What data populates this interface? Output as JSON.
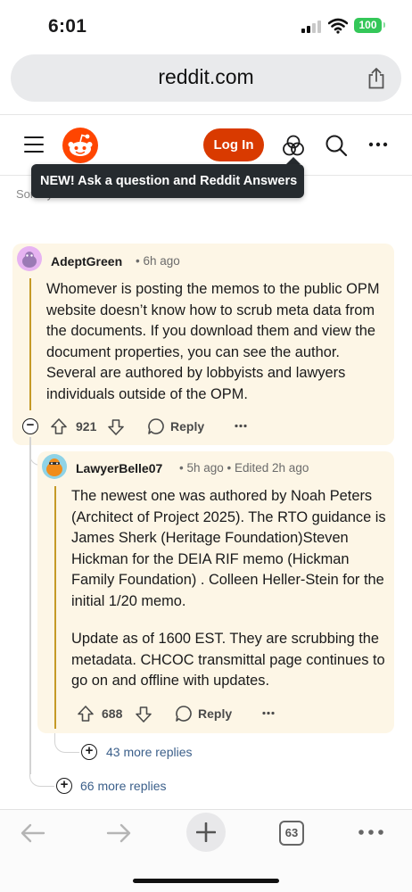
{
  "status_bar": {
    "time": "6:01",
    "battery": "100"
  },
  "browser": {
    "url": "reddit.com"
  },
  "header": {
    "login_label": "Log In"
  },
  "tooltip": {
    "text": "NEW! Ask a question and Reddit Answers"
  },
  "sort": {
    "text": "Sort by: Best"
  },
  "comments": [
    {
      "author": "AdeptGreen",
      "time": "6h ago",
      "body": "Whomever is posting the memos to the public OPM website doesn’t know how to scrub meta data from the documents. If you download them and view the document properties, you can see the author. Several are authored by lobbyists and lawyers individuals outside of the OPM.",
      "votes": "921",
      "reply_label": "Reply",
      "more_replies": "66 more replies"
    },
    {
      "author": "LawyerBelle07",
      "time": "5h ago",
      "edited": "Edited 2h ago",
      "body_p1": "The newest one was authored by Noah Peters (Architect of Project 2025). The RTO guidance is James Sherk (Heritage Foundation)Steven Hickman for the DEIA RIF memo (Hickman Family Foundation) . Colleen Heller-Stein for the initial 1/20 memo.",
      "body_p2": "Update as of 1600 EST. They are scrubbing the metadata. CHCOC transmittal page continues to go on and offline with updates.",
      "votes": "688",
      "reply_label": "Reply",
      "more_replies": "43 more replies"
    }
  ],
  "toolbar": {
    "tab_count": "63"
  },
  "colors": {
    "accent": "#d93a00",
    "highlight": "#fdf6e6",
    "thread": "#c59a27",
    "link": "#3b5f8a"
  },
  "icons": [
    "share-icon",
    "hamburger-icon",
    "reddit-logo",
    "answers-icon",
    "search-icon",
    "more-icon",
    "upvote-icon",
    "downvote-icon",
    "comment-icon",
    "collapse-icon",
    "expand-icon",
    "back-arrow-icon",
    "forward-arrow-icon",
    "plus-icon",
    "tabs-icon",
    "menu-icon"
  ]
}
